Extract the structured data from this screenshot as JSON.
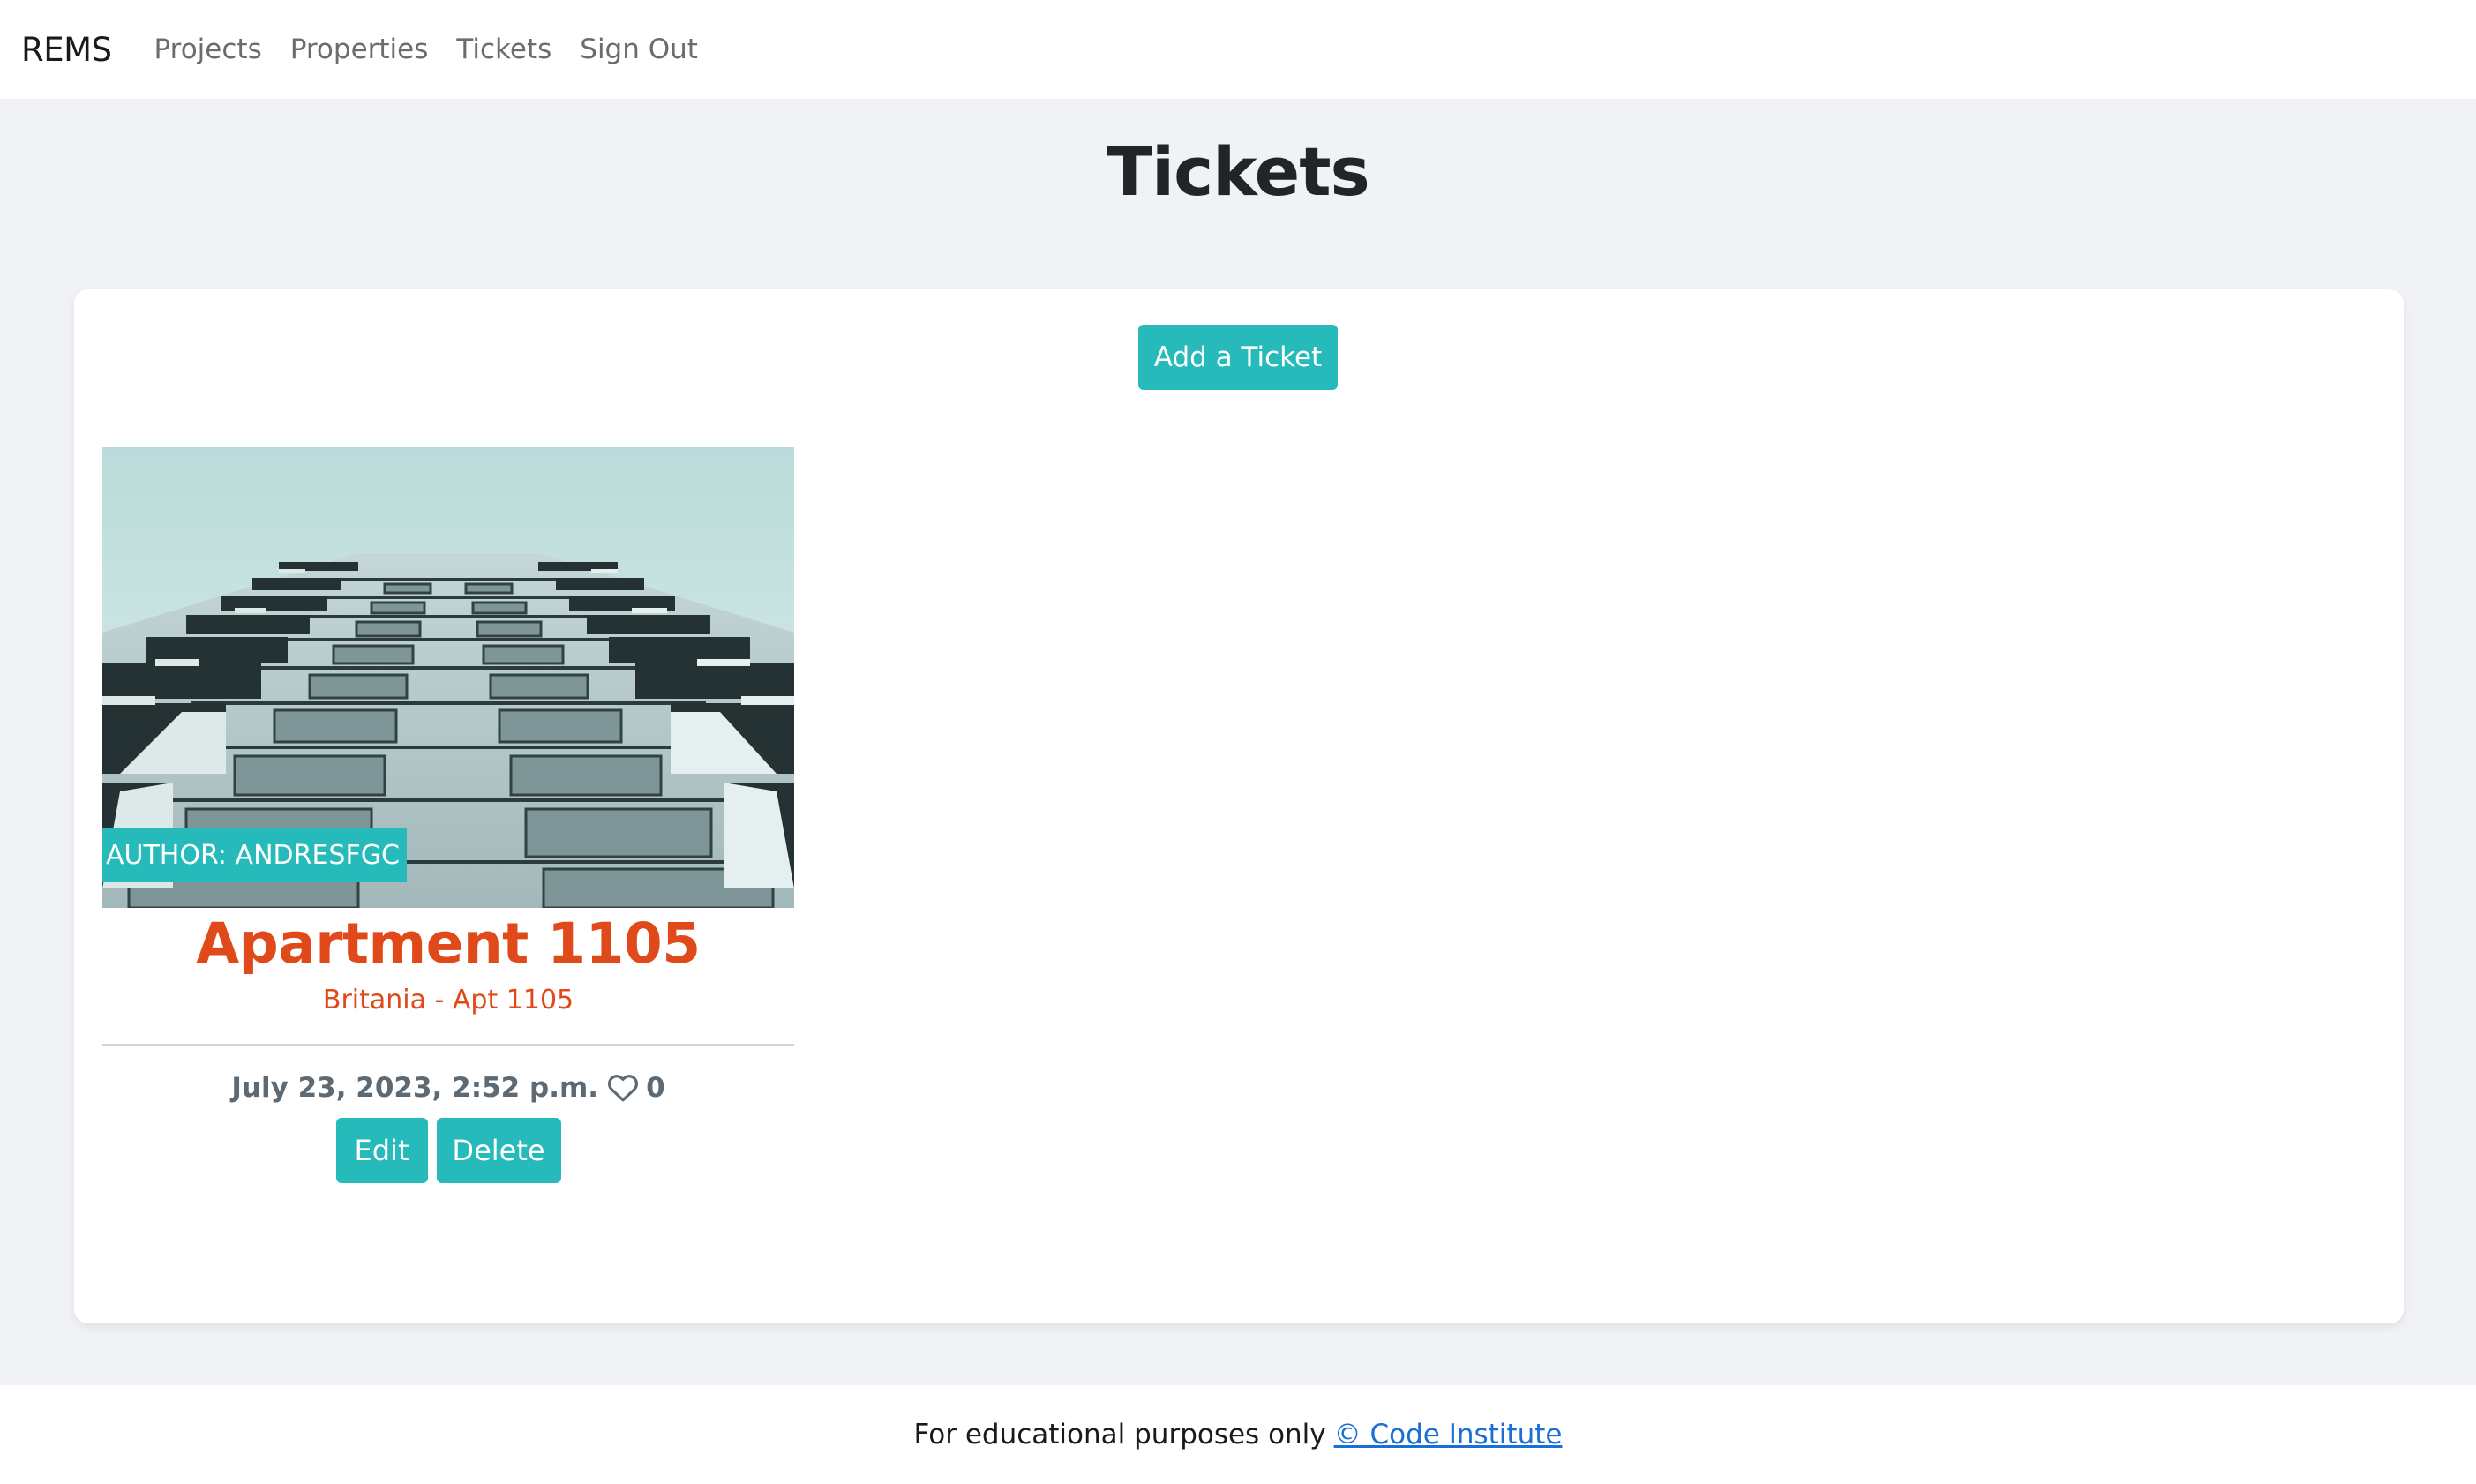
{
  "navbar": {
    "brand": "REMS",
    "links": [
      {
        "label": "Projects"
      },
      {
        "label": "Properties"
      },
      {
        "label": "Tickets"
      },
      {
        "label": "Sign Out"
      }
    ]
  },
  "page": {
    "title": "Tickets",
    "add_button_label": "Add a Ticket"
  },
  "ticket": {
    "author_badge": "AUTHOR: ANDRESFGC",
    "title": "Apartment 1105",
    "subtitle": "Britania - Apt 1105",
    "date": "July 23, 2023, 2:52 p.m.",
    "likes": "0",
    "edit_label": "Edit",
    "delete_label": "Delete",
    "image_icon": "building-photo"
  },
  "footer": {
    "text": "For educational purposes only",
    "link_label": "© Code Institute"
  },
  "colors": {
    "accent": "#26baba",
    "title_orange": "#e0491a",
    "background": "#f0f2f5"
  }
}
